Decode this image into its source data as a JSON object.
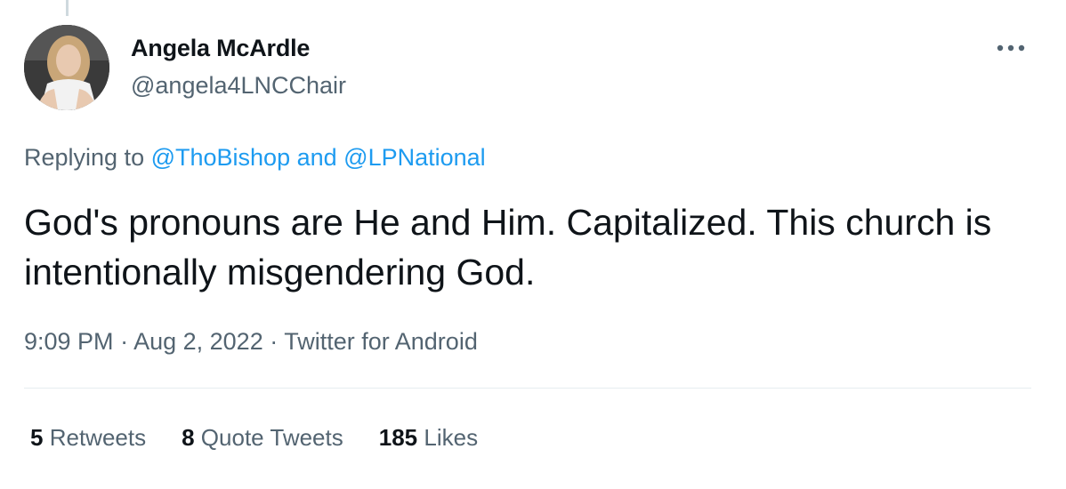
{
  "author": {
    "name": "Angela McArdle",
    "handle": "@angela4LNCChair"
  },
  "reply": {
    "prefix": "Replying to ",
    "to_1": "@ThoBishop",
    "joiner": " and ",
    "to_2": "@LPNational"
  },
  "tweet": {
    "text": "God's pronouns are He and Him. Capitalized. This church is intentionally misgendering God."
  },
  "meta": {
    "time": "9:09 PM",
    "sep1": " · ",
    "date": "Aug 2, 2022",
    "sep2": " · ",
    "source": "Twitter for Android"
  },
  "stats": {
    "retweets_count": "5",
    "retweets_label": "Retweets",
    "quotes_count": "8",
    "quotes_label": "Quote Tweets",
    "likes_count": "185",
    "likes_label": "Likes"
  },
  "icons": {
    "more": "more-horizontal-icon"
  },
  "colors": {
    "link": "#1d9bf0",
    "secondary_text": "#536471",
    "primary_text": "#0f1419",
    "divider": "#e6ecf0"
  }
}
